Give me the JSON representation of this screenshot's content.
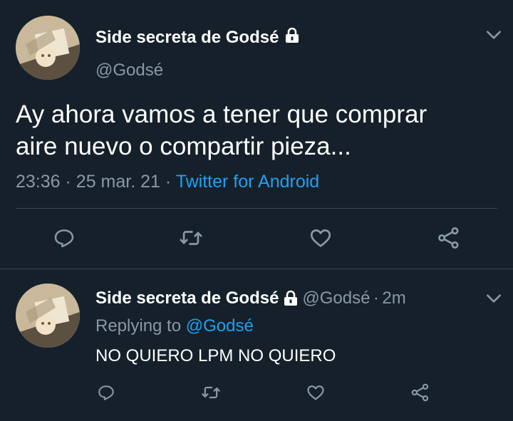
{
  "main_tweet": {
    "display_name": "Side secreta de Godsé",
    "handle": "@Godsé",
    "text_line1": "Ay ahora vamos a tener que comprar",
    "text_line2": "aire nuevo o compartir pieza...",
    "time": "23:36",
    "sep1": "·",
    "date": "25 mar. 21",
    "sep2": "·",
    "source": "Twitter for Android"
  },
  "reply_tweet": {
    "display_name": "Side secreta de Godsé",
    "handle": "@Godsé",
    "sep": "·",
    "age": "2m",
    "replying_prefix": "Replying to",
    "replying_handle": "@Godsé",
    "text": "NO QUIERO LPM NO QUIERO"
  },
  "icons": {
    "reply": "reply-icon",
    "retweet": "retweet-icon",
    "like": "heart-icon",
    "share": "share-icon",
    "lock": "lock-icon",
    "menu": "chevron-down-icon"
  },
  "colors": {
    "background": "#15202b",
    "secondary_text": "#8899a6",
    "link": "#1da1f2",
    "divider": "#38444d"
  }
}
